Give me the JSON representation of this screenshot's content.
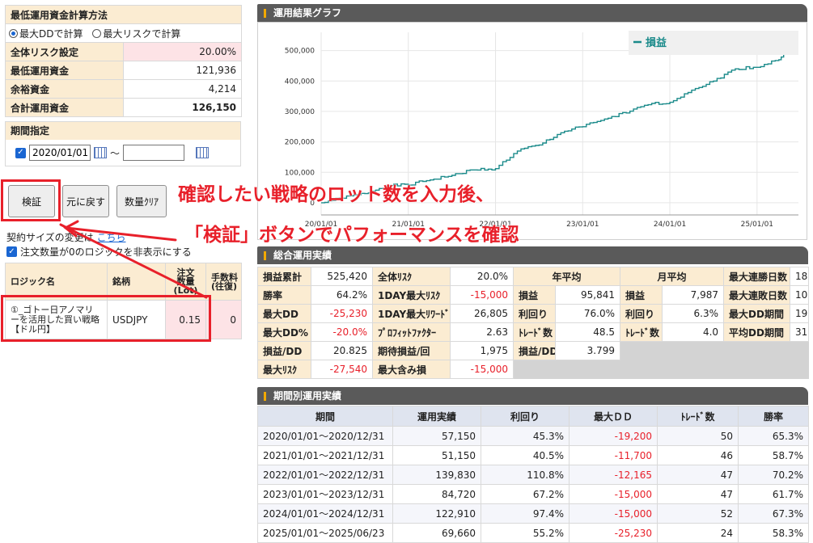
{
  "calc": {
    "title": "最低運用資金計算方法",
    "radio1": "最大DDで計算",
    "radio2": "最大リスクで計算",
    "rows": [
      {
        "label": "全体リスク設定",
        "value": "20.00%"
      },
      {
        "label": "最低運用資金",
        "value": "121,936"
      },
      {
        "label": "余裕資金",
        "value": "4,214"
      },
      {
        "label": "合計運用資金",
        "value": "126,150"
      }
    ]
  },
  "period": {
    "title": "期間指定",
    "start": "2020/01/01",
    "tilde": "～",
    "end": ""
  },
  "buttons": {
    "verify": "検証",
    "reset": "元に戻す",
    "clear": "数量ｸﾘｱ"
  },
  "links": {
    "lot_change_prefix": "契約サイズの変更は",
    "lot_change_link": "こちら",
    "hide_zero": "注文数量が0のロジックを非表示にする"
  },
  "lot_table": {
    "headers": [
      "ロジック名",
      "銘柄",
      "注文数量(Lot)",
      "手数料(往復)"
    ],
    "header_lines": [
      [
        "ロジック名"
      ],
      [
        "銘柄"
      ],
      [
        "注文",
        "数量",
        "(Lot)"
      ],
      [
        "手数料",
        "(往復)"
      ]
    ],
    "rows": [
      {
        "name": "①_ゴトー日アノマリーを活用した買い戦略【ドル円】",
        "symbol": "USDJPY",
        "qty": "0.15",
        "fee": "0"
      }
    ]
  },
  "chart_panel_title": "運用結果グラフ",
  "chart_data": {
    "type": "line",
    "series": [
      {
        "name": "損益",
        "color": "#1a8a8a"
      }
    ],
    "legend_label": "損益",
    "legend_position": "top-right",
    "yticks": [
      "0",
      "100,000",
      "200,000",
      "300,000",
      "400,000",
      "500,000"
    ],
    "ylim": [
      -40000,
      560000
    ],
    "xticks": [
      "20/01/01",
      "21/01/01",
      "22/01/01",
      "23/01/01",
      "24/01/01",
      "25/01/01"
    ],
    "x": [
      "2020-01",
      "2020-04",
      "2020-07",
      "2020-10",
      "2021-01",
      "2021-04",
      "2021-07",
      "2021-10",
      "2022-01",
      "2022-04",
      "2022-07",
      "2022-10",
      "2023-01",
      "2023-04",
      "2023-07",
      "2023-10",
      "2024-01",
      "2024-04",
      "2024-07",
      "2024-10",
      "2025-01",
      "2025-04",
      "2025-06"
    ],
    "values": [
      0,
      15000,
      30000,
      55000,
      58000,
      75000,
      90000,
      108000,
      112000,
      170000,
      190000,
      230000,
      250000,
      275000,
      295000,
      322000,
      330000,
      370000,
      400000,
      440000,
      445000,
      470000,
      525420
    ],
    "grid": true
  },
  "summary_title": "総合運用実績",
  "summary": {
    "col1": [
      {
        "label": "損益累計",
        "value": "525,420",
        "neg": false
      },
      {
        "label": "勝率",
        "value": "64.2%",
        "neg": false
      },
      {
        "label": "最大DD",
        "value": "-25,230",
        "neg": true
      },
      {
        "label": "最大DD%",
        "value": "-20.0%",
        "neg": true
      },
      {
        "label": "損益/DD",
        "value": "20.825",
        "neg": false
      },
      {
        "label": "最大ﾘｽｸ",
        "value": "-27,540",
        "neg": true
      }
    ],
    "col2": [
      {
        "label": "全体ﾘｽｸ",
        "value": "20.0%",
        "neg": false
      },
      {
        "label": "1DAY最大ﾘｽｸ",
        "value": "-15,000",
        "neg": true
      },
      {
        "label": "1DAY最大ﾘﾜｰﾄﾞ",
        "value": "26,805",
        "neg": false
      },
      {
        "label": "ﾌﾟﾛﾌｨｯﾄﾌｧｸﾀｰ",
        "value": "2.63",
        "neg": false
      },
      {
        "label": "期待損益/回",
        "value": "1,975",
        "neg": false
      },
      {
        "label": "最大含み損",
        "value": "-15,000",
        "neg": true
      }
    ],
    "yearly_header": "年平均",
    "yearly": [
      {
        "label": "損益",
        "value": "95,841"
      },
      {
        "label": "利回り",
        "value": "76.0%"
      },
      {
        "label": "ﾄﾚｰﾄﾞ数",
        "value": "48.5"
      },
      {
        "label": "損益/DD",
        "value": "3.799"
      }
    ],
    "monthly_header": "月平均",
    "monthly": [
      {
        "label": "損益",
        "value": "7,987"
      },
      {
        "label": "利回り",
        "value": "6.3%"
      },
      {
        "label": "ﾄﾚｰﾄﾞ数",
        "value": "4.0"
      }
    ],
    "col5": [
      {
        "label": "最大連勝日数",
        "value": "18"
      },
      {
        "label": "最大連敗日数",
        "value": "10"
      },
      {
        "label": "最大DD期間",
        "value": "199"
      },
      {
        "label": "平均DD期間",
        "value": "31"
      }
    ]
  },
  "period_title": "期間別運用実績",
  "period_table": {
    "headers": [
      "期間",
      "運用実績",
      "利回り",
      "最大ＤＤ",
      "ﾄﾚｰﾄﾞ数",
      "勝率"
    ],
    "rows": [
      [
        "2020/01/01～2020/12/31",
        "57,150",
        "45.3%",
        "-19,200",
        "50",
        "65.3%"
      ],
      [
        "2021/01/01～2021/12/31",
        "51,150",
        "40.5%",
        "-11,700",
        "46",
        "58.7%"
      ],
      [
        "2022/01/01～2022/12/31",
        "139,830",
        "110.8%",
        "-12,165",
        "47",
        "70.2%"
      ],
      [
        "2023/01/01～2023/12/31",
        "84,720",
        "67.2%",
        "-15,000",
        "47",
        "61.7%"
      ],
      [
        "2024/01/01～2024/12/31",
        "122,910",
        "97.4%",
        "-15,000",
        "52",
        "67.3%"
      ],
      [
        "2025/01/01～2025/06/23",
        "69,660",
        "55.2%",
        "-25,230",
        "24",
        "58.3%"
      ]
    ]
  },
  "annotation": {
    "line1": "確認したい戦略のロット数を入力後、",
    "line2": "「検証」ボタンでパフォーマンスを確認",
    "color": "#e8202a"
  }
}
